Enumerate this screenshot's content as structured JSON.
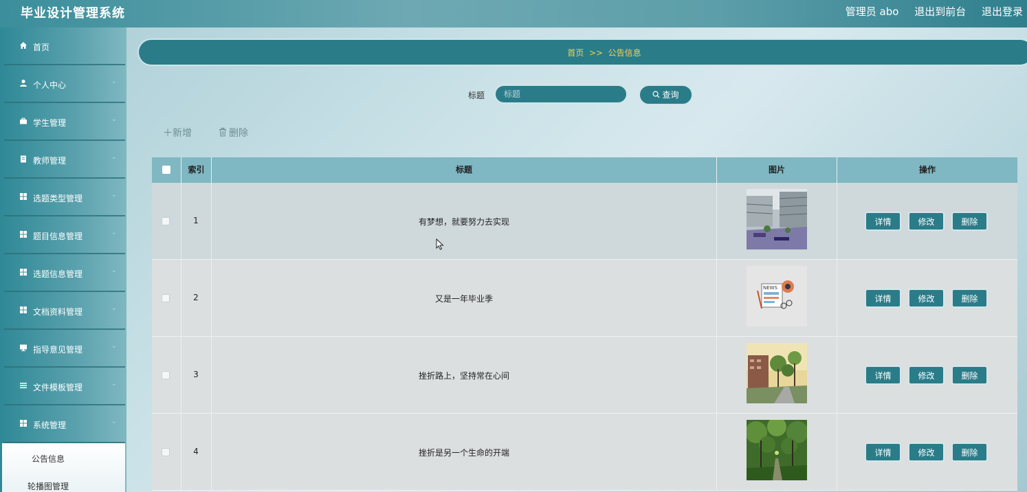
{
  "app": {
    "title": "毕业设计管理系统",
    "user_label": "管理员 abo",
    "back_to_front": "退出到前台",
    "logout": "退出登录"
  },
  "sidebar": {
    "items": [
      {
        "label": "首页",
        "icon": "home-icon"
      },
      {
        "label": "个人中心",
        "icon": "user-icon"
      },
      {
        "label": "学生管理",
        "icon": "briefcase-icon"
      },
      {
        "label": "教师管理",
        "icon": "clipboard-icon"
      },
      {
        "label": "选题类型管理",
        "icon": "grid-icon"
      },
      {
        "label": "题目信息管理",
        "icon": "grid-icon"
      },
      {
        "label": "选题信息管理",
        "icon": "grid-icon"
      },
      {
        "label": "文档资料管理",
        "icon": "grid-icon"
      },
      {
        "label": "指导意见管理",
        "icon": "monitor-icon"
      },
      {
        "label": "文件模板管理",
        "icon": "list-icon"
      },
      {
        "label": "系统管理",
        "icon": "grid-icon"
      }
    ],
    "submenu": [
      "公告信息",
      "轮播图管理"
    ]
  },
  "breadcrumb": {
    "text": "首页  >>  公告信息"
  },
  "search": {
    "label": "标题",
    "placeholder": "标题",
    "button": "查询"
  },
  "actions": {
    "add": "新增",
    "delete": "删除"
  },
  "table": {
    "headers": {
      "index": "索引",
      "title": "标题",
      "image": "图片",
      "ops": "操作"
    },
    "rows": [
      {
        "index": "1",
        "title": "有梦想，就要努力去实现"
      },
      {
        "index": "2",
        "title": "又是一年毕业季"
      },
      {
        "index": "3",
        "title": "挫折路上，坚持常在心间"
      },
      {
        "index": "4",
        "title": "挫折是另一个生命的开端"
      }
    ],
    "row_buttons": {
      "detail": "详情",
      "edit": "修改",
      "remove": "删除"
    }
  },
  "colors": {
    "primary": "#2a7c89",
    "breadcrumb_text": "#f3d250",
    "header": "#7fb7c2"
  }
}
